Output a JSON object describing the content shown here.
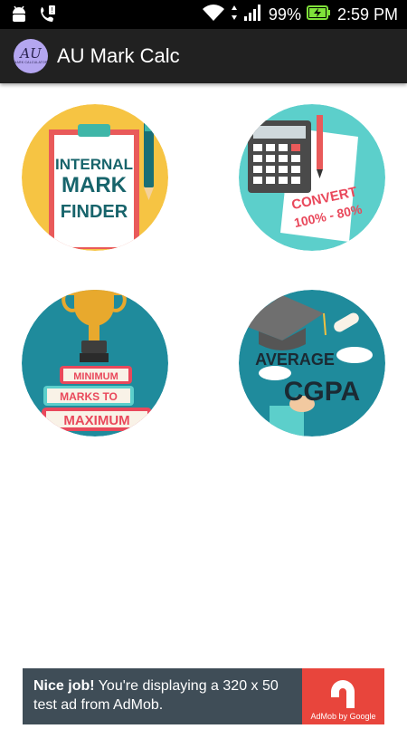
{
  "status_bar": {
    "battery": "99%",
    "time": "2:59 PM",
    "icons": [
      "android-icon",
      "call-notification-icon",
      "wifi-icon",
      "data-arrows-icon",
      "signal-icon",
      "battery-charging-icon"
    ]
  },
  "app_bar": {
    "logo_text": "AU",
    "logo_subtext": "MARK CALCULATOR",
    "title": "AU Mark Calc"
  },
  "tiles": [
    {
      "lines": [
        "INTERNAL",
        "MARK",
        "FINDER"
      ],
      "bg": "#f6c443",
      "icon": "clipboard-pen-icon"
    },
    {
      "lines": [
        "CONVERT",
        "100% - 80%"
      ],
      "bg": "#5ccfcb",
      "icon": "calculator-icon"
    },
    {
      "lines": [
        "MINIMUM",
        "MARKS TO",
        "MAXIMUM"
      ],
      "bg": "#1f8b9c",
      "icon": "trophy-icon"
    },
    {
      "lines": [
        "AVERAGE",
        "CGPA"
      ],
      "bg": "#1f8b9c",
      "icon": "graduation-cap-icon"
    }
  ],
  "ad": {
    "bold": "Nice job!",
    "text": " You're displaying a 320 x 50 test ad from AdMob.",
    "brand": "AdMob by Google",
    "colors": {
      "banner": "#3f4d57",
      "side": "#e8453c"
    }
  }
}
